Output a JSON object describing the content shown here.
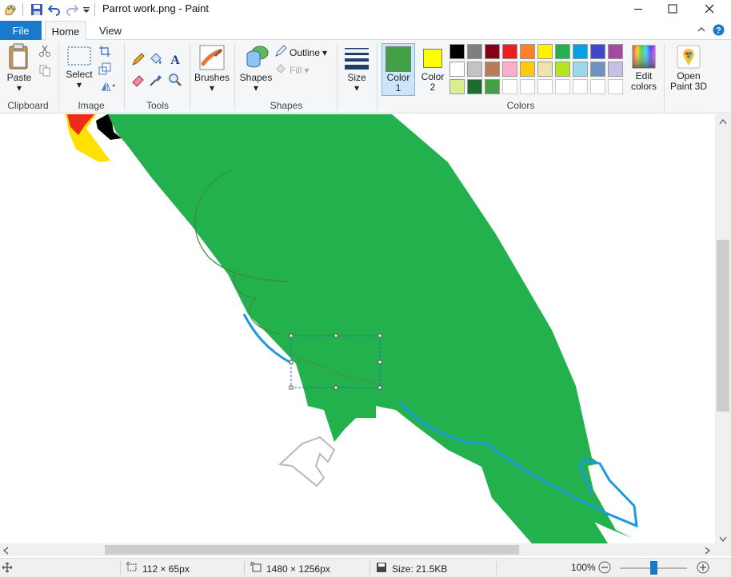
{
  "window": {
    "title": "Parrot work.png - Paint",
    "minimize_icon": "minimize-icon",
    "maximize_icon": "maximize-icon",
    "close_icon": "close-icon"
  },
  "tabs": {
    "file": "File",
    "home": "Home",
    "view": "View"
  },
  "ribbon": {
    "clipboard": {
      "paste": "Paste",
      "label": "Clipboard"
    },
    "image": {
      "select": "Select",
      "label": "Image"
    },
    "tools": {
      "label": "Tools"
    },
    "brushes": {
      "label": "Brushes"
    },
    "shapes": {
      "shapes": "Shapes",
      "outline": "Outline",
      "fill": "Fill",
      "label": "Shapes"
    },
    "size": {
      "label": "Size"
    },
    "colors": {
      "color1_line1": "Color",
      "color1_line2": "1",
      "color2_line1": "Color",
      "color2_line2": "2",
      "edit_line1": "Edit",
      "edit_line2": "colors",
      "label": "Colors",
      "color1": "#43a047",
      "color2": "#ffff00",
      "palette": [
        [
          "#000000",
          "#7f7f7f",
          "#880015",
          "#ed1c24",
          "#ff7f27",
          "#fff200",
          "#22b14c",
          "#00a2e8",
          "#3f48cc",
          "#a349a4"
        ],
        [
          "#ffffff",
          "#c3c3c3",
          "#b97a57",
          "#ffaec9",
          "#ffc90e",
          "#efe4b0",
          "#b5e61d",
          "#99d9ea",
          "#7092be",
          "#c8bfe7"
        ],
        [
          "#d9ef8b",
          "#1e6b2e",
          "#43a047",
          "",
          "",
          "",
          "",
          "",
          "",
          ""
        ]
      ]
    },
    "paint3d": {
      "line1": "Open",
      "line2": "Paint 3D"
    }
  },
  "status": {
    "selection_size": "112 × 65px",
    "image_size": "1480 × 1256px",
    "file_size": "Size: 21.5KB",
    "zoom": "100%"
  }
}
